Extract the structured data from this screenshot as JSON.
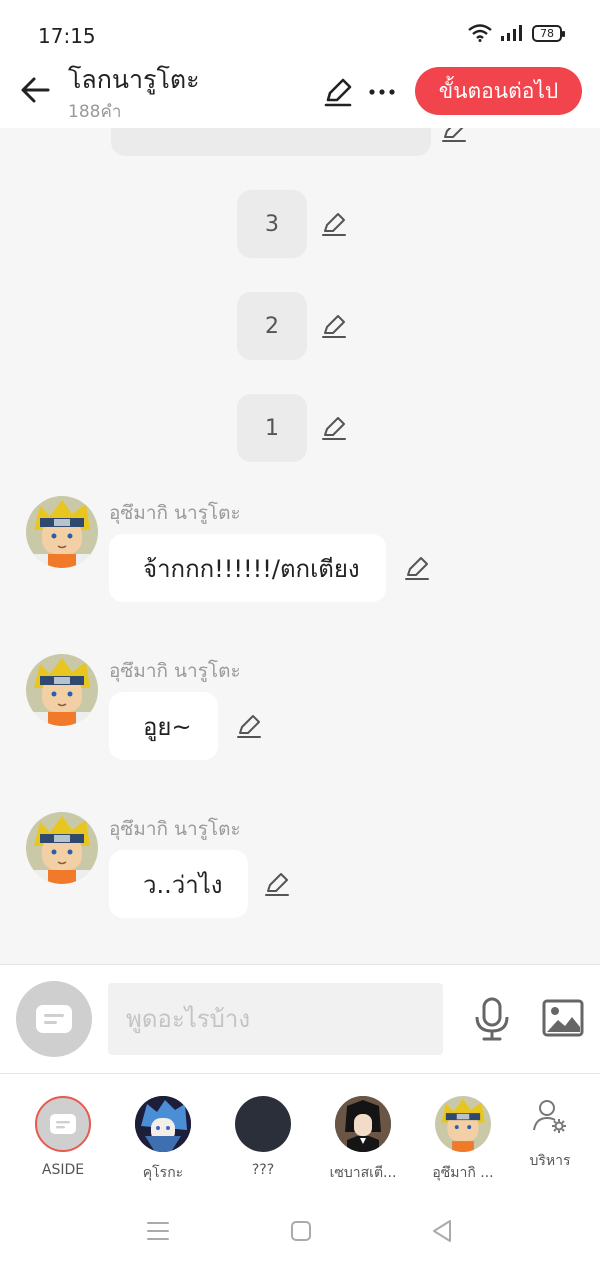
{
  "status": {
    "time": "17:15",
    "battery": "78"
  },
  "header": {
    "title": "โลกนารูโตะ",
    "subtitle": "188คำ",
    "next_label": "ขั้นตอนต่อไป"
  },
  "chat": {
    "narrations": [
      "3",
      "2",
      "1"
    ],
    "messages": [
      {
        "sender": "อุซึมากิ นารูโตะ",
        "text": "จ้ากกก!!!!!!/ตกเตียง"
      },
      {
        "sender": "อุซึมากิ นารูโตะ",
        "text": "อูย~"
      },
      {
        "sender": "อุซึมากิ นารูโตะ",
        "text": "ว..ว่าไง"
      }
    ]
  },
  "input": {
    "placeholder": "พูดอะไรบ้าง"
  },
  "characters": [
    {
      "name": "ASIDE"
    },
    {
      "name": "คุโรกะ"
    },
    {
      "name": "???"
    },
    {
      "name": "เซบาสเตี..."
    },
    {
      "name": "อุซึมากิ ..."
    }
  ],
  "manage_label": "บริหาร",
  "colors": {
    "accent": "#f2444d",
    "aside_ring": "#e8594f",
    "background": "#f6f6f6"
  }
}
